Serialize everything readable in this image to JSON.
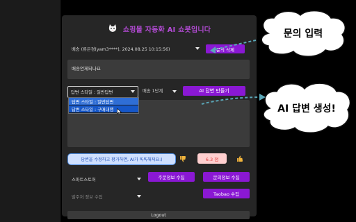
{
  "header": {
    "title": "쇼핑몰 자동화 AI 쇼봇입니다",
    "logo_icon": "cat-icon"
  },
  "order_select": {
    "value": "배송 (류은경(yam3****), 2024.08.25 10:15:56)"
  },
  "buttons": {
    "delete_inquiry": "문의 삭제",
    "generate_answer": "AI 답변 만들기",
    "collect_order_info": "주문정보 수집",
    "collect_inquiry_info": "문의정보 수집",
    "collect_taobao": "Taobao 수집",
    "logout": "Logout"
  },
  "inquiry_message": "배송언제되나요",
  "answer_style": {
    "selected": "답변 스타일 : 일반답변",
    "options": [
      "답변 스타일 : 일반답변",
      "답변 스타일 : 구매대행"
    ]
  },
  "stage_select": {
    "value": "배송 1단계"
  },
  "feedback": {
    "hint": "답변을 수정하고 평가하면, AI가 똑똑해져요:)",
    "score": "6.3 점",
    "thumbs_down_icon": "thumbs-down-icon",
    "thumbs_up_icon": "thumbs-up-icon"
  },
  "store_select": {
    "value": "스마트스토어"
  },
  "orderer_select": {
    "placeholder": "발주처 정보 수집"
  },
  "callouts": {
    "inquiry_input": "문의 입력",
    "ai_answer": "AI 답변 생성!"
  },
  "colors": {
    "accent": "#8a18d3",
    "arrow": "#5aa7b8",
    "dropdown_highlight": "#1657c8"
  }
}
